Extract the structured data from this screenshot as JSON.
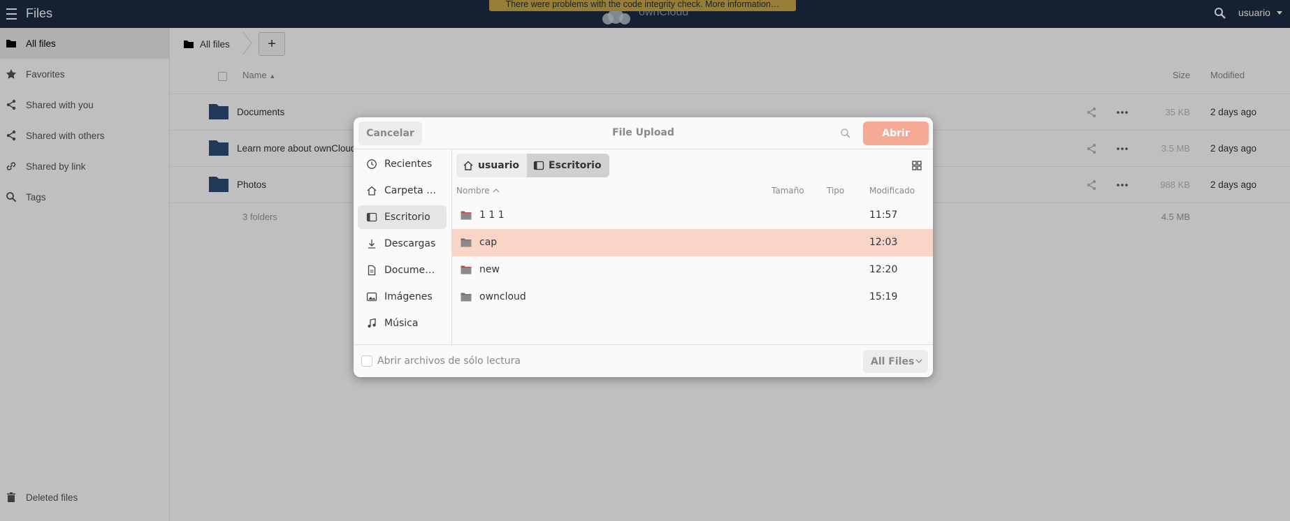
{
  "header": {
    "app_title": "Files",
    "warning": "There were problems with the code integrity check. More information…",
    "logo_text": "ownCloud",
    "user": "usuario"
  },
  "sidebar": {
    "items": [
      {
        "label": "All files",
        "icon": "folder-icon"
      },
      {
        "label": "Favorites",
        "icon": "star-icon"
      },
      {
        "label": "Shared with you",
        "icon": "share-icon"
      },
      {
        "label": "Shared with others",
        "icon": "share-icon"
      },
      {
        "label": "Shared by link",
        "icon": "link-icon"
      },
      {
        "label": "Tags",
        "icon": "search-icon"
      }
    ],
    "deleted": "Deleted files"
  },
  "main": {
    "breadcrumb": "All files",
    "add_label": "+",
    "columns": {
      "name": "Name",
      "size": "Size",
      "modified": "Modified"
    },
    "rows": [
      {
        "name": "Documents",
        "size": "35 KB",
        "modified": "2 days ago"
      },
      {
        "name": "Learn more about ownCloud",
        "size": "3.5 MB",
        "modified": "2 days ago"
      },
      {
        "name": "Photos",
        "size": "988 KB",
        "modified": "2 days ago"
      }
    ],
    "summary": {
      "count": "3 folders",
      "total": "4.5 MB"
    }
  },
  "dialog": {
    "title": "File Upload",
    "cancel": "Cancelar",
    "open": "Abrir",
    "places": [
      {
        "label": "Recientes",
        "icon": "clock-icon"
      },
      {
        "label": "Carpeta …",
        "icon": "home-icon"
      },
      {
        "label": "Escritorio",
        "icon": "desktop-icon"
      },
      {
        "label": "Descargas",
        "icon": "download-icon"
      },
      {
        "label": "Docume…",
        "icon": "document-icon"
      },
      {
        "label": "Imágenes",
        "icon": "image-icon"
      },
      {
        "label": "Música",
        "icon": "music-icon"
      }
    ],
    "path": [
      {
        "label": "usuario",
        "icon": "home-icon"
      },
      {
        "label": "Escritorio",
        "icon": "desktop-icon"
      }
    ],
    "columns": {
      "name": "Nombre",
      "size": "Tamaño",
      "type": "Tipo",
      "modified": "Modificado"
    },
    "files": [
      {
        "name": "1 1 1",
        "modified": "11:57"
      },
      {
        "name": "cap",
        "modified": "12:03"
      },
      {
        "name": "new",
        "modified": "12:20"
      },
      {
        "name": "owncloud",
        "modified": "15:19"
      }
    ],
    "readonly_label": "Abrir archivos de sólo lectura",
    "filter": "All Files"
  },
  "colors": {
    "header_bg": "#1d2d44",
    "warning_bg": "#c9a94b",
    "folder": "#2f4d78",
    "accent": "#f4aa94",
    "selected_row": "#f9d5c8"
  }
}
